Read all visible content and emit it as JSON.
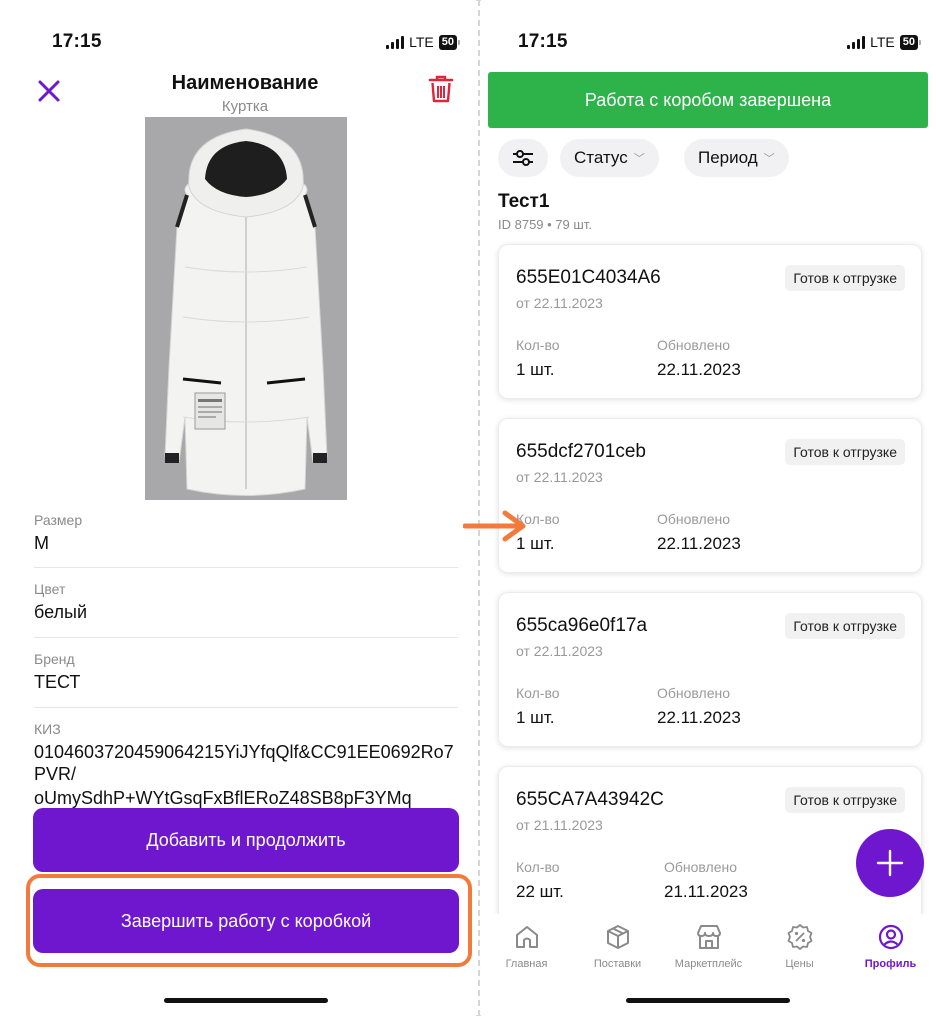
{
  "left": {
    "status": {
      "time": "17:15",
      "network": "LTE",
      "battery": "50"
    },
    "header": {
      "title": "Наименование",
      "subtitle": "Куртка"
    },
    "fields": [
      {
        "label": "Размер",
        "value": "M"
      },
      {
        "label": "Цвет",
        "value": "белый"
      },
      {
        "label": "Бренд",
        "value": "ТЕСТ"
      },
      {
        "label": "КИЗ",
        "value": "0104603720459064215YiJYfqQlf&CC91EE0692Ro7PVR/"
      },
      {
        "value": "oUmySdhP+WYtGsqFxBflERoZ48SB8pF3YMq"
      }
    ],
    "buttons": {
      "add_continue": "Добавить и продолжить",
      "finish_box": "Завершить работу с коробкой"
    }
  },
  "right": {
    "status": {
      "time": "17:15",
      "network": "LTE",
      "battery": "50"
    },
    "done_button": "Работа с коробом завершена",
    "filters": {
      "status": "Статус",
      "period": "Период"
    },
    "box": {
      "title": "Тест1",
      "meta": "ID 8759 • 79 шт."
    },
    "cards": [
      {
        "code": "655E01C4034A6",
        "date": "от 22.11.2023",
        "badge": "Готов к отгрузке",
        "qty_label": "Кол-во",
        "qty": "1 шт.",
        "updated_label": "Обновлено",
        "updated": "22.11.2023"
      },
      {
        "code": "655dcf2701ceb",
        "date": "от 22.11.2023",
        "badge": "Готов к отгрузке",
        "qty_label": "Кол-во",
        "qty": "1 шт.",
        "updated_label": "Обновлено",
        "updated": "22.11.2023"
      },
      {
        "code": "655ca96e0f17a",
        "date": "от 22.11.2023",
        "badge": "Готов к отгрузке",
        "qty_label": "Кол-во",
        "qty": "1 шт.",
        "updated_label": "Обновлено",
        "updated": "22.11.2023"
      },
      {
        "code": "655CA7A43942C",
        "date": "от 21.11.2023",
        "badge": "Готов к отгрузке",
        "qty_label": "Кол-во",
        "qty": "22 шт.",
        "updated_label": "Обновлено",
        "updated": "21.11.2023"
      }
    ],
    "tabs": [
      {
        "label": "Главная",
        "icon": "home-icon"
      },
      {
        "label": "Поставки",
        "icon": "box-icon"
      },
      {
        "label": "Маркетплейс",
        "icon": "store-icon"
      },
      {
        "label": "Цены",
        "icon": "percent-icon"
      },
      {
        "label": "Профиль",
        "icon": "profile-icon",
        "active": true
      }
    ]
  },
  "colors": {
    "accent": "#6f17cf",
    "success": "#2db34a",
    "highlight": "#f47a3c",
    "danger": "#e0243c"
  }
}
